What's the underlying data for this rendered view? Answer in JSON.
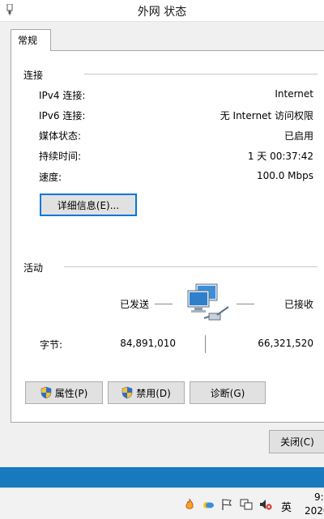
{
  "window": {
    "title": "外网 状态"
  },
  "tabs": [
    {
      "label": "常规"
    }
  ],
  "connection": {
    "section_title": "连接",
    "rows": [
      {
        "label": "IPv4 连接:",
        "value": "Internet"
      },
      {
        "label": "IPv6 连接:",
        "value": "无 Internet 访问权限"
      },
      {
        "label": "媒体状态:",
        "value": "已启用"
      },
      {
        "label": "持续时间:",
        "value": "1 天 00:37:42"
      },
      {
        "label": "速度:",
        "value": "100.0 Mbps"
      }
    ],
    "details_button": "详细信息(E)..."
  },
  "activity": {
    "section_title": "活动",
    "sent_label": "已发送",
    "received_label": "已接收",
    "bytes_label": "字节:",
    "bytes_sent": "84,891,010",
    "bytes_received": "66,321,520"
  },
  "buttons": {
    "properties": "属性(P)",
    "disable": "禁用(D)",
    "diagnose": "诊断(G)",
    "close": "关闭(C)"
  },
  "taskbar": {
    "ime": "英",
    "clock_time": "9:",
    "clock_date": "2020"
  },
  "colors": {
    "accent": "#0078d7",
    "taskbar_blue": "#1879bf"
  }
}
